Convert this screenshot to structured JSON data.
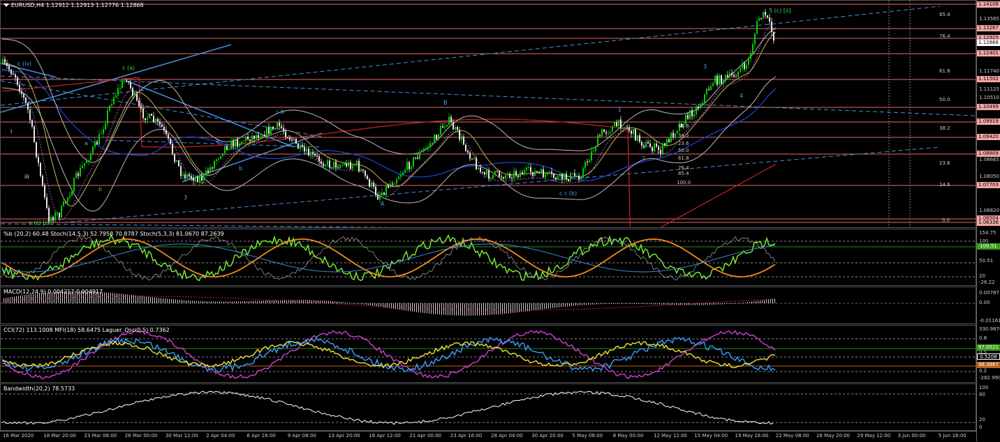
{
  "chart": {
    "symbol_line": "EURUSD,H4  1.12912 1.12913 1.12776 1.12868",
    "colors": {
      "up": "#00d000",
      "down": "#e6e6e6",
      "hline": "#e06c6c",
      "ma_red": "#c22",
      "ma_blue": "#2244dd",
      "trend": "#4a90d9"
    }
  },
  "price_axis": {
    "tags": [
      {
        "v": "1.14108",
        "style": "normal"
      },
      {
        "v": "1.13267",
        "style": "normal"
      },
      {
        "v": "1.12925",
        "style": "normal"
      },
      {
        "v": "1.12868",
        "style": "cur"
      },
      {
        "v": "1.12401",
        "style": "normal"
      },
      {
        "v": "1.11502",
        "style": "normal"
      },
      {
        "v": "1.10499",
        "style": "normal"
      },
      {
        "v": "1.09919",
        "style": "normal"
      },
      {
        "v": "1.09420",
        "style": "normal"
      },
      {
        "v": "1.08809",
        "style": "normal"
      },
      {
        "v": "1.07703",
        "style": "normal"
      },
      {
        "v": "1.06504",
        "style": "normal"
      },
      {
        "v": "1.06336",
        "style": "normal"
      }
    ],
    "labels": [
      "1.13585",
      "1.11740",
      "1.11125",
      "1.10510",
      "1.08665",
      "1.08050",
      "1.06820"
    ]
  },
  "fib_right": [
    "85.4",
    "76.4",
    "61.8",
    "50.0",
    "38.2",
    "23.6",
    "14.6",
    "0.0"
  ],
  "fib_mid": [
    "61.8",
    "50.0",
    "38.2",
    "23.6",
    "0.0",
    "50.0",
    "61.8",
    "76.4",
    "85.4",
    "100.0"
  ],
  "waves": {
    "top_label": "5 (c) [ii]",
    "labels": [
      "c (iv)",
      "i",
      "iii",
      "v (c) [i]",
      "a",
      "b",
      "c (a)",
      "3",
      "a",
      "b",
      "c b",
      "A",
      "B",
      "A",
      "B",
      "c c (b)",
      "1",
      "2",
      "3",
      "4"
    ]
  },
  "stoch": {
    "title": "%b (20,2) 60.48  Stoch(14,5,3) 52.7958 70.8787  Stoch(5,3,3) 81.0670 87.2639",
    "axis": [
      "154.75",
      "100",
      "50.51",
      "20",
      "-26.22"
    ],
    "tag": "100.51"
  },
  "macd": {
    "title": "MACD(12,24,9) 0.004217 0.004917",
    "axis": [
      "0.00787",
      "0.00",
      "-0.01161"
    ]
  },
  "cci": {
    "title": "CCI(72) 113.1008  MFI(18) 58.6475  Laguer_Osc(0.5) 0.7362",
    "axis": [
      "330.9870",
      "0.8",
      "0.5",
      "0.2",
      "-282.9907"
    ],
    "tags": [
      "97.0521",
      "0.5208",
      "98.3867"
    ]
  },
  "bandwidth": {
    "title": "Bandwidth(20,2) 78.5733",
    "axis": [
      "100",
      "80",
      "20",
      "0"
    ]
  },
  "time_axis": [
    "16 Mar 2020",
    "18 Mar 20:00",
    "23 Mar 08:00",
    "26 Mar 00:00",
    "30 Mar 12:00",
    "2 Apr 04:00",
    "6 Apr 16:00",
    "9 Apr 08:00",
    "13 Apr 20:00",
    "16 Apr 12:00",
    "21 Apr 00:00",
    "23 Apr 16:00",
    "28 Apr 04:00",
    "30 Apr 20:00",
    "5 May 08:00",
    "8 May 00:00",
    "12 May 12:00",
    "15 May 04:00",
    "19 May 16:00",
    "22 May 08:00",
    "26 May 20:00",
    "29 May 12:00",
    "3 Jun 00:00",
    "5 Jun 16:00"
  ]
}
